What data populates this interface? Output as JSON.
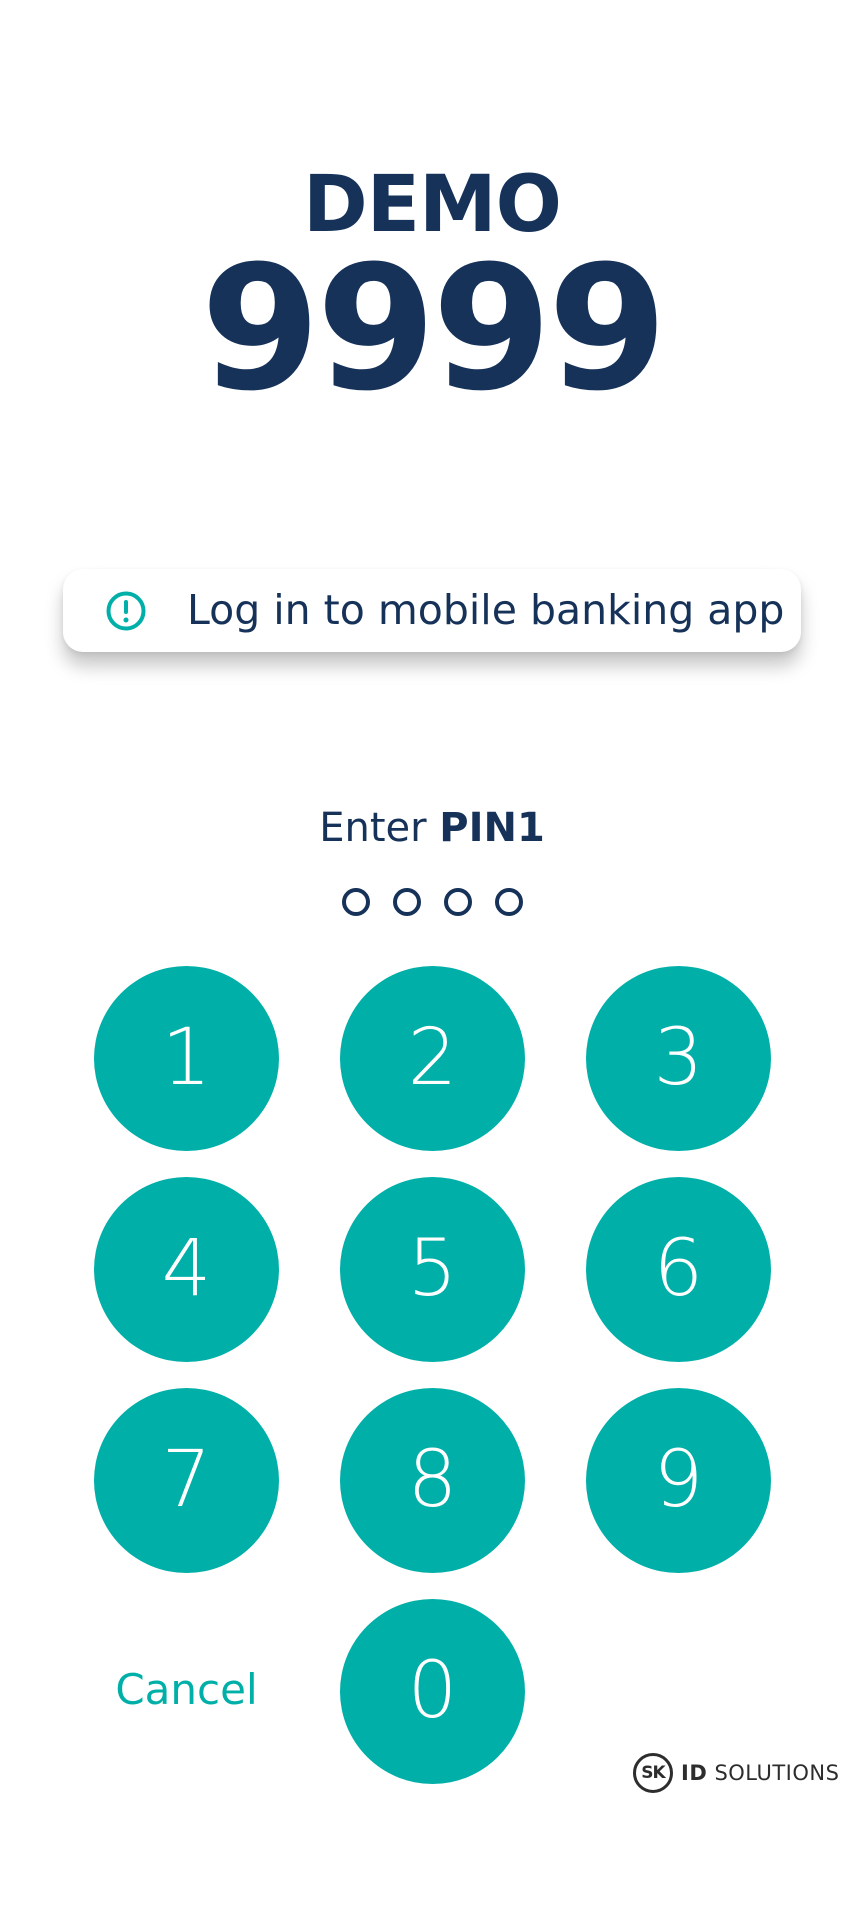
{
  "header": {
    "environment": "DEMO",
    "verification_code": "9999"
  },
  "info": {
    "icon": "alert-circle-icon",
    "message": "Log in to mobile banking app",
    "accent_color": "#00afa8"
  },
  "pin": {
    "label_prefix": "Enter",
    "label_strong": "PIN1",
    "entered_count": 0,
    "length": 4
  },
  "keypad": {
    "keys": [
      "1",
      "2",
      "3",
      "4",
      "5",
      "6",
      "7",
      "8",
      "9",
      "0"
    ],
    "key_color": "#00afa8",
    "cancel_label": "Cancel"
  },
  "brand": {
    "mark": "SK",
    "name_strong": "ID",
    "name_rest": "SOLUTIONS"
  },
  "colors": {
    "primary_text": "#163259",
    "accent": "#00afa8",
    "background": "#ffffff"
  }
}
